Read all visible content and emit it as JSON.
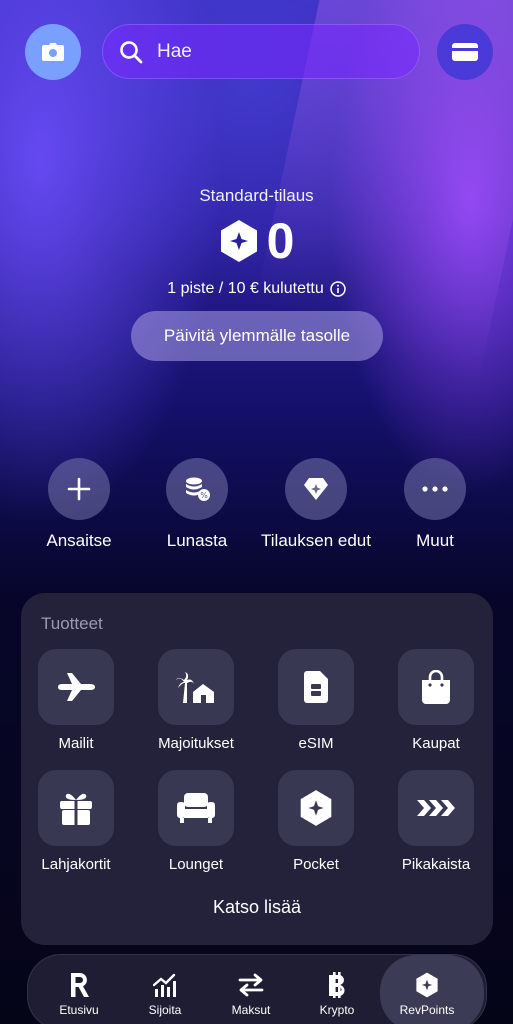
{
  "search": {
    "placeholder": "Hae"
  },
  "hero": {
    "tier": "Standard-tilaus",
    "points": "0",
    "rate": "1 piste / 10 € kulutettu",
    "upgrade_label": "Päivitä ylemmälle tasolle"
  },
  "actions": [
    {
      "label": "Ansaitse",
      "icon": "plus-icon"
    },
    {
      "label": "Lunasta",
      "icon": "coins-icon"
    },
    {
      "label": "Tilauksen edut",
      "icon": "diamond-icon"
    },
    {
      "label": "Muut",
      "icon": "more-icon"
    }
  ],
  "products": {
    "title": "Tuotteet",
    "items": [
      {
        "label": "Mailit",
        "icon": "airplane-icon"
      },
      {
        "label": "Majoitukset",
        "icon": "palm-house-icon"
      },
      {
        "label": "eSIM",
        "icon": "sim-icon"
      },
      {
        "label": "Kaupat",
        "icon": "shopping-bag-icon"
      },
      {
        "label": "Lahjakortit",
        "icon": "gift-icon"
      },
      {
        "label": "Lounget",
        "icon": "armchair-icon"
      },
      {
        "label": "Pocket",
        "icon": "revpoints-icon"
      },
      {
        "label": "Pikakaista",
        "icon": "fast-lane-icon"
      }
    ],
    "more_label": "Katso lisää"
  },
  "nav": [
    {
      "label": "Etusivu",
      "icon": "revolut-icon"
    },
    {
      "label": "Sijoita",
      "icon": "chart-icon"
    },
    {
      "label": "Maksut",
      "icon": "transfer-icon"
    },
    {
      "label": "Krypto",
      "icon": "bitcoin-icon"
    },
    {
      "label": "RevPoints",
      "icon": "revpoints-icon",
      "active": true
    }
  ],
  "colors": {
    "camera_button": "#7aa0ff",
    "panel": "#23223a",
    "tile": "#393852"
  }
}
